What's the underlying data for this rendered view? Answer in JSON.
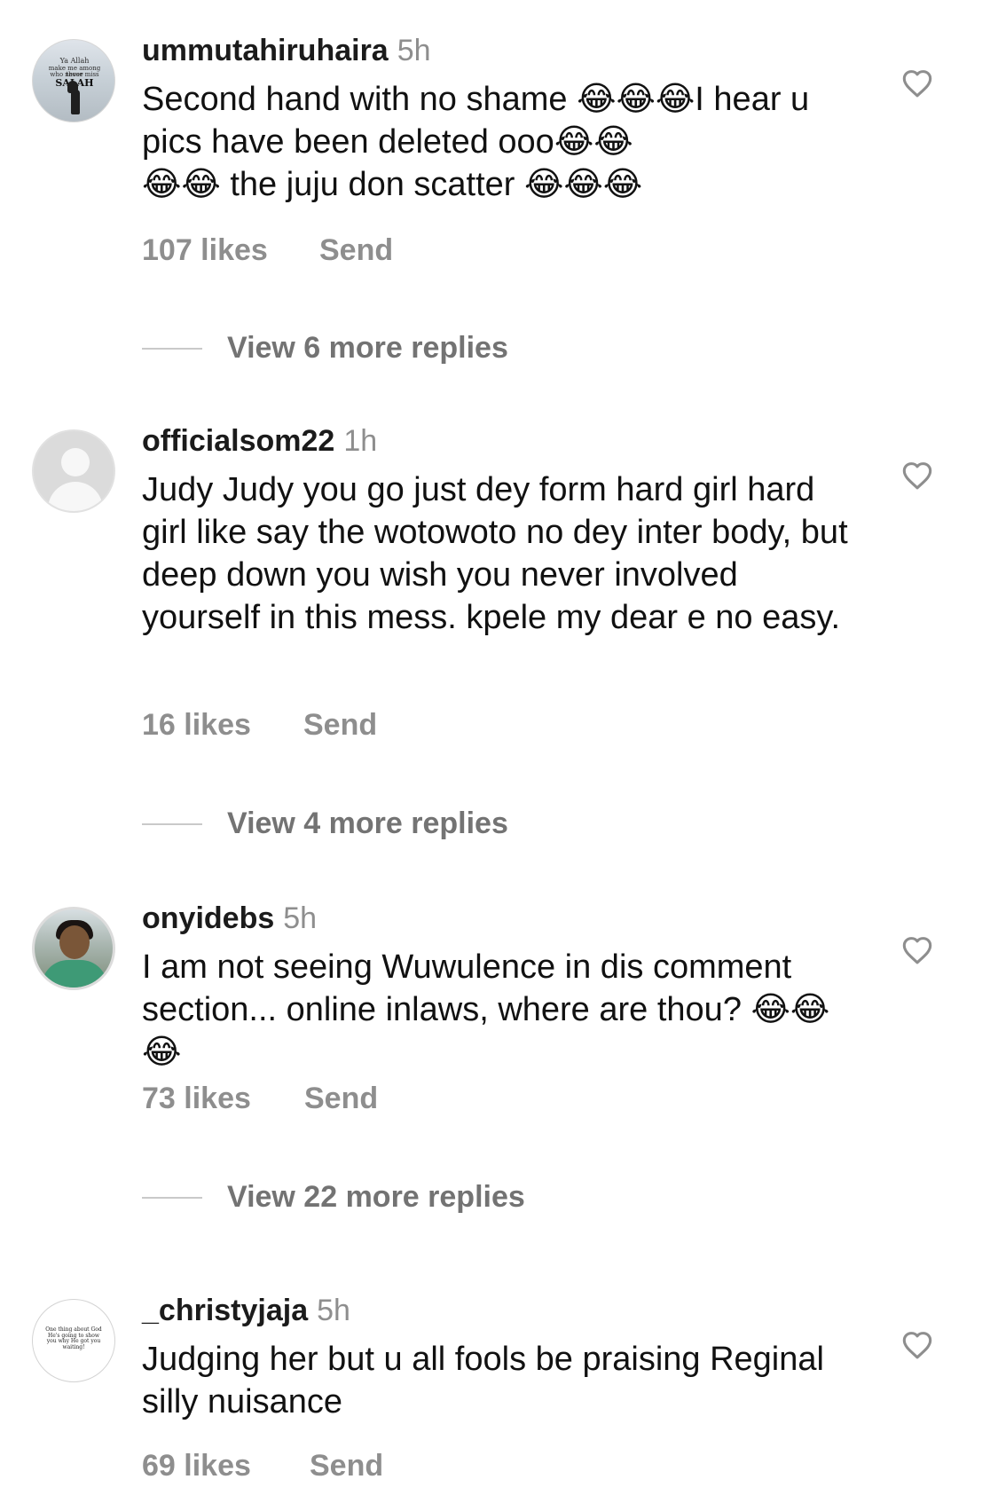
{
  "comments": [
    {
      "username": "ummutahiruhaira",
      "time": "5h",
      "text": "Second hand with no shame 😂😂😂I hear u pics have been deleted ooo😂😂\n😂😂 the juju don scatter 😂😂😂",
      "likes": "107 likes",
      "send": "Send",
      "replies": "View 6 more replies",
      "avatar_text": [
        "Ya Allah",
        "make me among those",
        "who never miss",
        "SALAH"
      ]
    },
    {
      "username": "officialsom22",
      "time": "1h",
      "text": "Judy Judy you go just dey form hard girl hard girl like say the wotowoto no dey inter body, but deep down you wish you never involved yourself in this mess. kpele my dear e no easy.",
      "likes": "16 likes",
      "send": "Send",
      "replies": "View 4 more replies"
    },
    {
      "username": "onyidebs",
      "time": "5h",
      "text": "I am not seeing Wuwulence in dis comment section... online inlaws, where are thou? 😂😂😂",
      "likes": "73 likes",
      "send": "Send",
      "replies": "View 22 more replies"
    },
    {
      "username": "_christyjaja",
      "time": "5h",
      "text": "Judging her but u all fools be praising Reginal silly nuisance",
      "likes": "69 likes",
      "send": "Send",
      "avatar_text": "One thing about God He's going to show you why He got you waiting!"
    }
  ],
  "icons": {
    "like": "heart-outline-icon"
  },
  "colors": {
    "background": "#ffffff",
    "primary_text": "#111111",
    "secondary_text": "#8e8e8e"
  }
}
